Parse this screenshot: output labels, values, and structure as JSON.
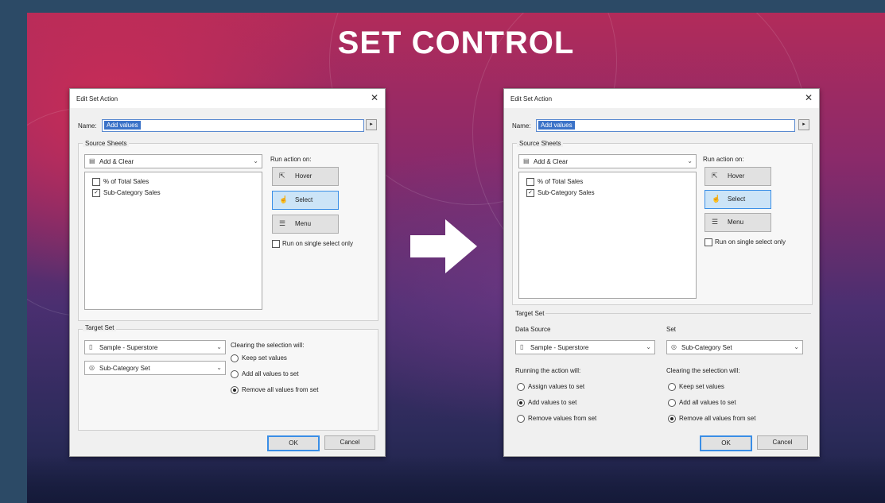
{
  "slide": {
    "title": "SET CONTROL"
  },
  "dialog_left": {
    "window_title": "Edit Set Action",
    "close_glyph": "✕",
    "name_label": "Name:",
    "name_value": "Add values",
    "source_sheets_label": "Source Sheets",
    "source_dropdown": "Add & Clear",
    "sheets": [
      {
        "label": "% of Total Sales",
        "checked": false
      },
      {
        "label": "Sub-Category Sales",
        "checked": true
      }
    ],
    "run_action_label": "Run action on:",
    "run_buttons": {
      "hover": "Hover",
      "select": "Select",
      "menu": "Menu"
    },
    "single_select_label": "Run on single select only",
    "target_set_label": "Target Set",
    "target_source": "Sample - Superstore",
    "target_set": "Sub-Category Set",
    "clearing_label": "Clearing the selection will:",
    "clearing_options": [
      {
        "label": "Keep set values",
        "selected": false
      },
      {
        "label": "Add all values to set",
        "selected": false
      },
      {
        "label": "Remove all values from set",
        "selected": true
      }
    ],
    "ok_label": "OK",
    "cancel_label": "Cancel"
  },
  "dialog_right": {
    "window_title": "Edit Set Action",
    "close_glyph": "✕",
    "name_label": "Name:",
    "name_value": "Add values",
    "source_sheets_label": "Source Sheets",
    "source_dropdown": "Add & Clear",
    "sheets": [
      {
        "label": "% of Total Sales",
        "checked": false
      },
      {
        "label": "Sub-Category Sales",
        "checked": true
      }
    ],
    "run_action_label": "Run action on:",
    "run_buttons": {
      "hover": "Hover",
      "select": "Select",
      "menu": "Menu"
    },
    "single_select_label": "Run on single select only",
    "target_set_label": "Target Set",
    "data_source_label": "Data Source",
    "data_source_value": "Sample - Superstore",
    "set_label": "Set",
    "set_value": "Sub-Category Set",
    "running_label": "Running the action will:",
    "running_options": [
      {
        "label": "Assign values to set",
        "selected": false
      },
      {
        "label": "Add values to set",
        "selected": true
      },
      {
        "label": "Remove values from set",
        "selected": false
      }
    ],
    "clearing_label": "Clearing the selection will:",
    "clearing_options": [
      {
        "label": "Keep set values",
        "selected": false
      },
      {
        "label": "Add all values to set",
        "selected": false
      },
      {
        "label": "Remove all values from set",
        "selected": true
      }
    ],
    "ok_label": "OK",
    "cancel_label": "Cancel"
  },
  "icons": {
    "hover": "⇱",
    "select": "☝",
    "menu": "☰",
    "sheet": "▤",
    "db": "▯",
    "set": "◎",
    "chevron": "⌄",
    "play": "▸",
    "check": "✓"
  },
  "colors": {
    "accent": "#3a8ee6",
    "selection": "#3a72c8"
  }
}
